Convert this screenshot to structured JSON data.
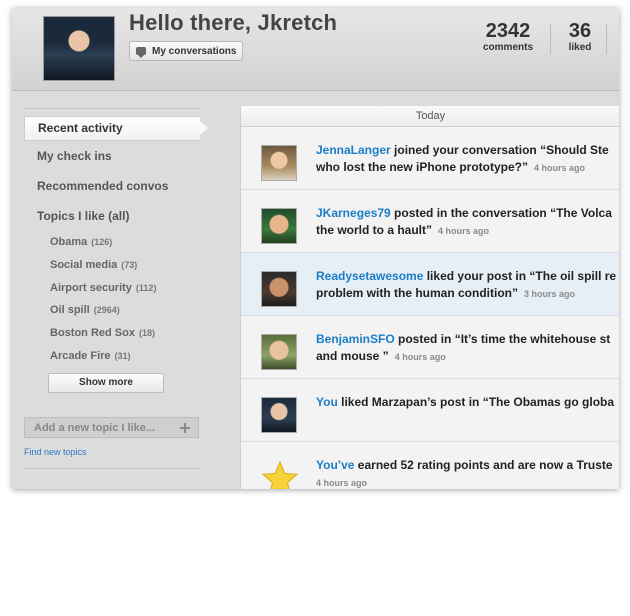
{
  "header": {
    "greeting": "Hello there, Jkretch",
    "conversations_button": "My conversations",
    "stats": [
      {
        "number": "2342",
        "label": "comments"
      },
      {
        "number": "36",
        "label": "liked"
      }
    ]
  },
  "sidebar": {
    "nav": [
      {
        "label": "Recent activity",
        "active": true
      },
      {
        "label": "My check ins"
      },
      {
        "label": "Recommended convos"
      },
      {
        "label": "Topics I like (all)"
      }
    ],
    "topics": [
      {
        "name": "Obama",
        "count": "(126)"
      },
      {
        "name": "Social media",
        "count": "(73)"
      },
      {
        "name": "Airport security",
        "count": "(112)"
      },
      {
        "name": "Oil spill",
        "count": "(2964)"
      },
      {
        "name": "Boston Red Sox",
        "count": "(18)"
      },
      {
        "name": "Arcade Fire",
        "count": "(31)"
      }
    ],
    "show_more": "Show more",
    "add_topic_placeholder": "Add a new topic I like...",
    "find_topics": "Find new topics"
  },
  "feed": {
    "header": "Today",
    "items": [
      {
        "user": "JennaLanger",
        "line1": " joined your conversation “Should Ste",
        "line2": "who lost the new iPhone prototype?”",
        "time": "4 hours ago",
        "avatar": "woman-avatar"
      },
      {
        "user": "JKarneges79",
        "line1": " posted in the conversation “The Volca",
        "line2": "the world to a hault”",
        "time": "4 hours ago",
        "avatar": "man-avatar"
      },
      {
        "user": "Readysetawesome",
        "line1": " liked your post in “The oil spill re",
        "line2": "problem with the human condition”",
        "time": "3 hours ago",
        "avatar": "bearded-man-avatar",
        "highlight": true
      },
      {
        "user": "BenjaminSFO",
        "line1": " posted in “It’s time the whitehouse st",
        "line2": "and mouse ”",
        "time": "4 hours ago",
        "avatar": "young-man-avatar"
      },
      {
        "user": "You",
        "line1": " liked Marzapan’s post in “The Obamas go globa",
        "line2": "",
        "time": "",
        "avatar": "user-avatar"
      },
      {
        "user": "You’ve",
        "line1": " earned 52 rating points and are now a Truste",
        "line2": "",
        "time": "4 hours ago",
        "avatar": "star-icon"
      }
    ]
  },
  "colors": {
    "link": "#1b7ec6",
    "highlight_row": "#e6eef6"
  }
}
